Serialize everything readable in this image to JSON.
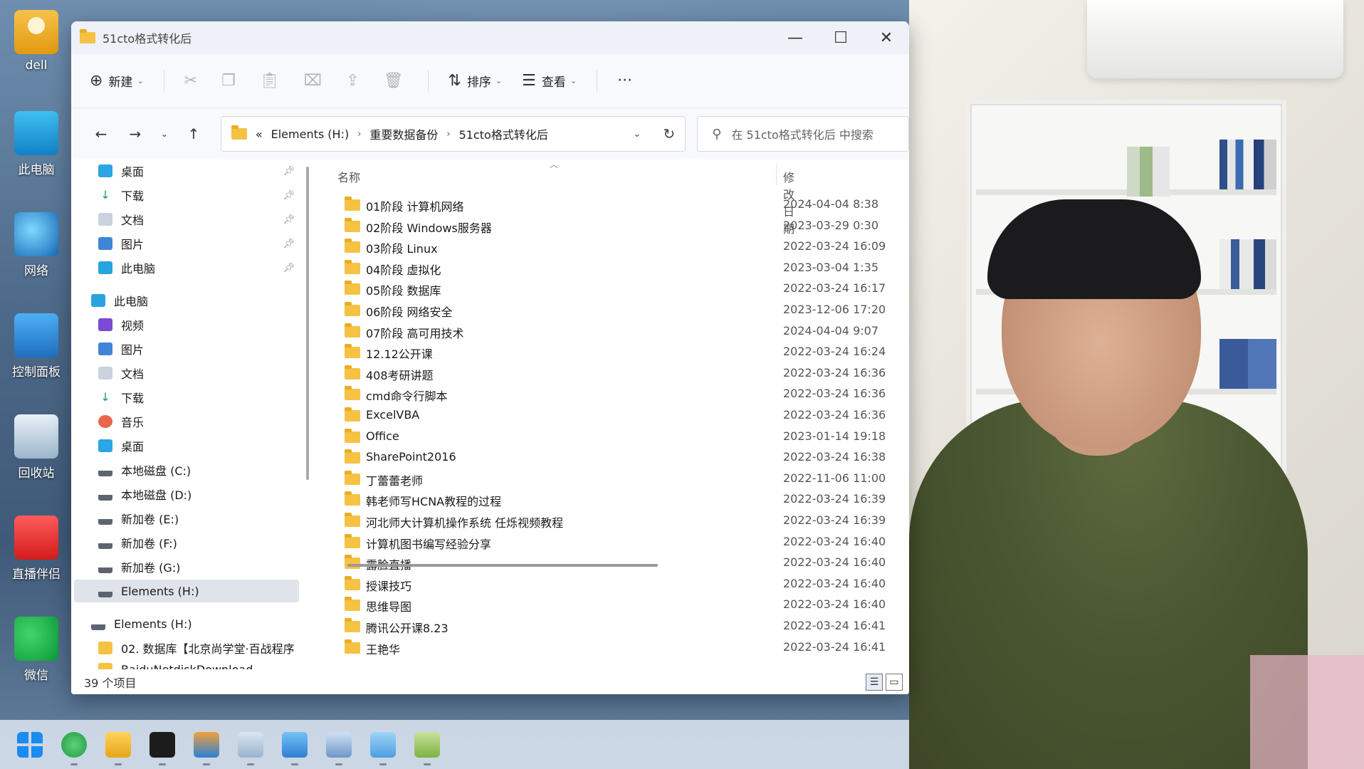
{
  "desktop": {
    "icons": [
      {
        "label": "dell",
        "icon": "user-folder-icon"
      },
      {
        "label": "此电脑",
        "icon": "computer-icon"
      },
      {
        "label": "网络",
        "icon": "network-icon"
      },
      {
        "label": "控制面板",
        "icon": "control-panel-icon"
      },
      {
        "label": "回收站",
        "icon": "recycle-bin-icon"
      },
      {
        "label": "直播伴侣",
        "icon": "live-companion-icon"
      },
      {
        "label": "微信",
        "icon": "wechat-icon"
      }
    ]
  },
  "window": {
    "title": "51cto格式转化后",
    "controls": {
      "minimize": "—",
      "maximize": "☐",
      "close": "✕"
    }
  },
  "toolbar": {
    "new_label": "新建",
    "sort_label": "排序",
    "view_label": "查看",
    "more_label": "···"
  },
  "address": {
    "overflow": "«",
    "crumbs": [
      "Elements (H:)",
      "重要数据备份",
      "51cto格式转化后"
    ]
  },
  "search": {
    "placeholder": "在 51cto格式转化后 中搜索"
  },
  "nav_pane": {
    "quick_access": [
      {
        "label": "桌面",
        "icon": "desktop-icon"
      },
      {
        "label": "下载",
        "icon": "download-icon"
      },
      {
        "label": "文档",
        "icon": "document-icon"
      },
      {
        "label": "图片",
        "icon": "pictures-icon"
      },
      {
        "label": "此电脑",
        "icon": "computer-icon"
      }
    ],
    "this_pc_label": "此电脑",
    "this_pc_items": [
      {
        "label": "视频",
        "icon": "video-icon"
      },
      {
        "label": "图片",
        "icon": "pictures-icon"
      },
      {
        "label": "文档",
        "icon": "document-icon"
      },
      {
        "label": "下载",
        "icon": "download-icon"
      },
      {
        "label": "音乐",
        "icon": "music-icon"
      },
      {
        "label": "桌面",
        "icon": "desktop-icon"
      },
      {
        "label": "本地磁盘 (C:)",
        "icon": "drive-icon"
      },
      {
        "label": "本地磁盘 (D:)",
        "icon": "drive-icon"
      },
      {
        "label": "新加卷 (E:)",
        "icon": "drive-icon"
      },
      {
        "label": "新加卷 (F:)",
        "icon": "drive-icon"
      },
      {
        "label": "新加卷 (G:)",
        "icon": "drive-icon"
      },
      {
        "label": "Elements (H:)",
        "icon": "drive-icon"
      }
    ],
    "elements_label": "Elements (H:)",
    "elements_items": [
      {
        "label": "02. 数据库【北京尚学堂·百战程序",
        "icon": "folder-icon"
      },
      {
        "label": "BaiduNetdiskDownload",
        "icon": "folder-icon"
      }
    ]
  },
  "columns": {
    "name": "名称",
    "date": "修改日期"
  },
  "files": [
    {
      "name": "01阶段 计算机网络",
      "date": "2024-04-04 8:38"
    },
    {
      "name": "02阶段 Windows服务器",
      "date": "2023-03-29 0:30"
    },
    {
      "name": "03阶段 Linux",
      "date": "2022-03-24 16:09"
    },
    {
      "name": "04阶段 虚拟化",
      "date": "2023-03-04 1:35"
    },
    {
      "name": "05阶段 数据库",
      "date": "2022-03-24 16:17"
    },
    {
      "name": "06阶段 网络安全",
      "date": "2023-12-06 17:20"
    },
    {
      "name": "07阶段 高可用技术",
      "date": "2024-04-04 9:07"
    },
    {
      "name": "12.12公开课",
      "date": "2022-03-24 16:24"
    },
    {
      "name": "408考研讲题",
      "date": "2022-03-24 16:36"
    },
    {
      "name": "cmd命令行脚本",
      "date": "2022-03-24 16:36"
    },
    {
      "name": "ExcelVBA",
      "date": "2022-03-24 16:36"
    },
    {
      "name": "Office",
      "date": "2023-01-14 19:18"
    },
    {
      "name": "SharePoint2016",
      "date": "2022-03-24 16:38"
    },
    {
      "name": "丁蕾蕾老师",
      "date": "2022-11-06 11:00"
    },
    {
      "name": "韩老师写HCNA教程的过程",
      "date": "2022-03-24 16:39"
    },
    {
      "name": "河北师大计算机操作系统 任烁视频教程",
      "date": "2022-03-24 16:39"
    },
    {
      "name": "计算机图书编写经验分享",
      "date": "2022-03-24 16:40"
    },
    {
      "name": "露脸直播",
      "date": "2022-03-24 16:40"
    },
    {
      "name": "授课技巧",
      "date": "2022-03-24 16:40"
    },
    {
      "name": "思维导图",
      "date": "2022-03-24 16:40"
    },
    {
      "name": "腾讯公开课8.23",
      "date": "2022-03-24 16:41"
    },
    {
      "name": "王艳华",
      "date": "2022-03-24 16:41"
    }
  ],
  "status": {
    "count": "39 个项目"
  },
  "colors": {
    "folder": "#f5c243",
    "accent": "#1a8cf0",
    "selection": "#dfe3ea"
  }
}
